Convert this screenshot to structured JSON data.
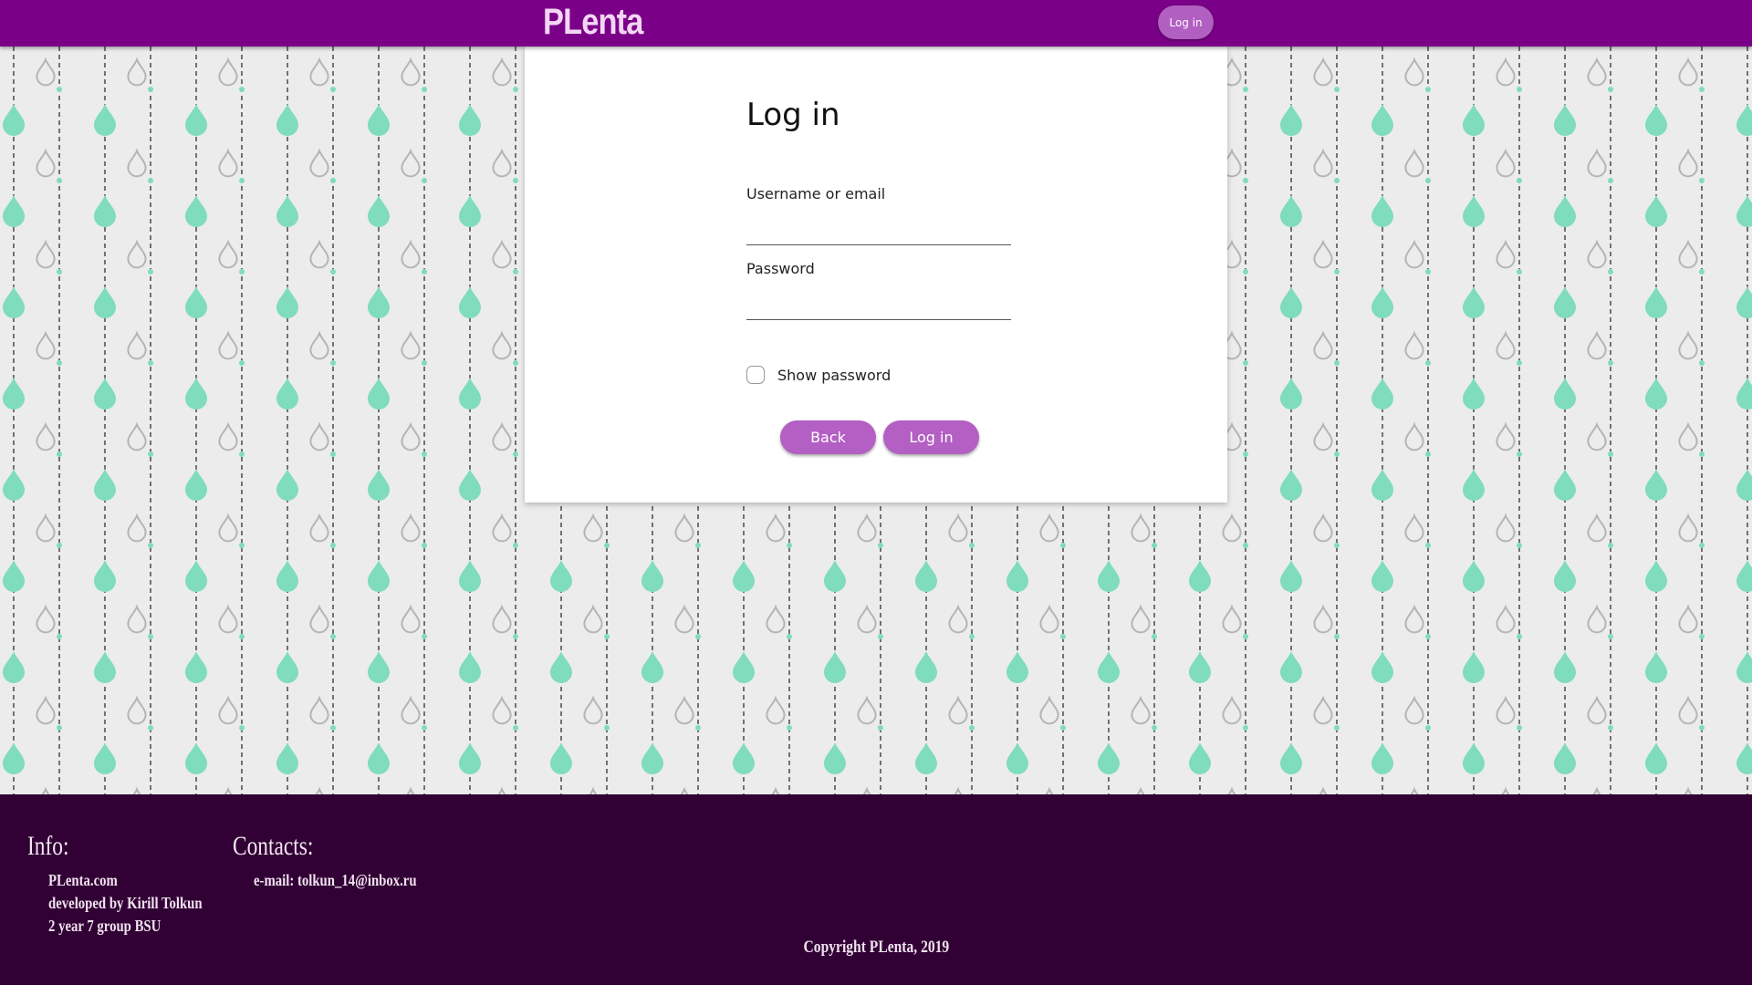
{
  "header": {
    "brand": "PLenta",
    "login_button": "Log in",
    "bar_color": "#7b0088"
  },
  "login_form": {
    "title": "Log in",
    "username_label": "Username or email",
    "username_value": "",
    "password_label": "Password",
    "password_value": "",
    "show_password_label": "Show password",
    "show_password_checked": false,
    "back_button": "Back",
    "submit_button": "Log in",
    "button_color": "#b35fc3"
  },
  "background": {
    "pattern_icons": [
      "drop-filled-icon",
      "drop-outline-icon"
    ],
    "drop_color": "#7fdcbd",
    "outline_color": "#b5b5b5",
    "base_color": "#ececec"
  },
  "footer": {
    "info": {
      "heading": "Info:",
      "lines": [
        "PLenta.com",
        "developed by Kirill Tolkun",
        "2 year 7 group BSU"
      ]
    },
    "contacts": {
      "heading": "Contacts:",
      "lines": [
        "e-mail: tolkun_14@inbox.ru"
      ]
    },
    "copyright": "Copyright PLenta, 2019",
    "bg_color": "#310034"
  }
}
